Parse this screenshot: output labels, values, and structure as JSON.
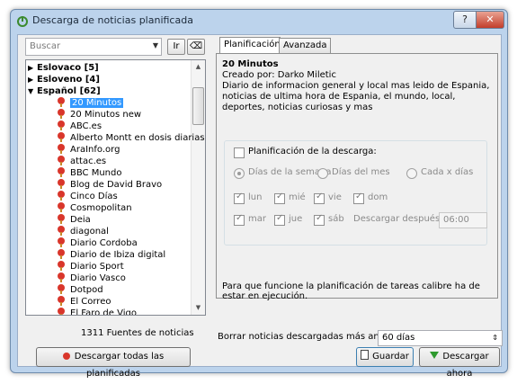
{
  "window": {
    "title": "Descarga de noticias planificada",
    "help_glyph": "?",
    "close_glyph": "✕"
  },
  "search": {
    "placeholder": "Buscar",
    "reset_glyph": "Ir",
    "clear_glyph": "⌫"
  },
  "tree": {
    "categories": [
      {
        "label": "Eslovaco [5]",
        "expanded": false
      },
      {
        "label": "Esloveno [4]",
        "expanded": false
      },
      {
        "label": "Español [62]",
        "expanded": true
      }
    ],
    "items": [
      "20 Minutos",
      "20 Minutos new",
      "ABC.es",
      "Alberto Montt en dosis diarias",
      "AraInfo.org",
      "attac.es",
      "BBC Mundo",
      "Blog de David Bravo",
      "Cinco Días",
      "Cosmopolitan",
      "Deia",
      "diagonal",
      "Diario Cordoba",
      "Diario de Ibiza digital",
      "Diario Sport",
      "Diario Vasco",
      "Dotpod",
      "El Correo",
      "El Faro de Vigo"
    ],
    "selected": "20 Minutos"
  },
  "footer_left": {
    "count_label": "1311 Fuentes de noticias",
    "download_all_label": "Descargar todas las planificadas"
  },
  "tabs": [
    "Planificación",
    "Avanzada"
  ],
  "recipe": {
    "title": "20 Minutos",
    "author": "Creado por: Darko Miletic",
    "description": "Diario de informacion general y local mas leido de Espania, noticias de ultima hora de Espania, el mundo, local, deportes, noticias curiosas y mas"
  },
  "schedule": {
    "enable_label": "Planificación de la descarga:",
    "radios": [
      "Días de la semana",
      "Días del mes",
      "Cada x días"
    ],
    "days": [
      "lun",
      "mié",
      "vie",
      "dom",
      "mar",
      "jue",
      "sáb"
    ],
    "after_label": "Descargar después de:",
    "after_value": "06:00",
    "note": "Para que funcione la planificación de tareas calibre ha de estar en ejecución."
  },
  "bottom": {
    "delete_label": "Borrar noticias descargadas más antiguas de:",
    "delete_value": "60 días",
    "save_label": "Guardar",
    "download_now_label": "Descargar ahora"
  },
  "colors": {
    "selection": "#3399ff",
    "pin": "#d9362b",
    "title_bar": "#bcd3ec"
  }
}
